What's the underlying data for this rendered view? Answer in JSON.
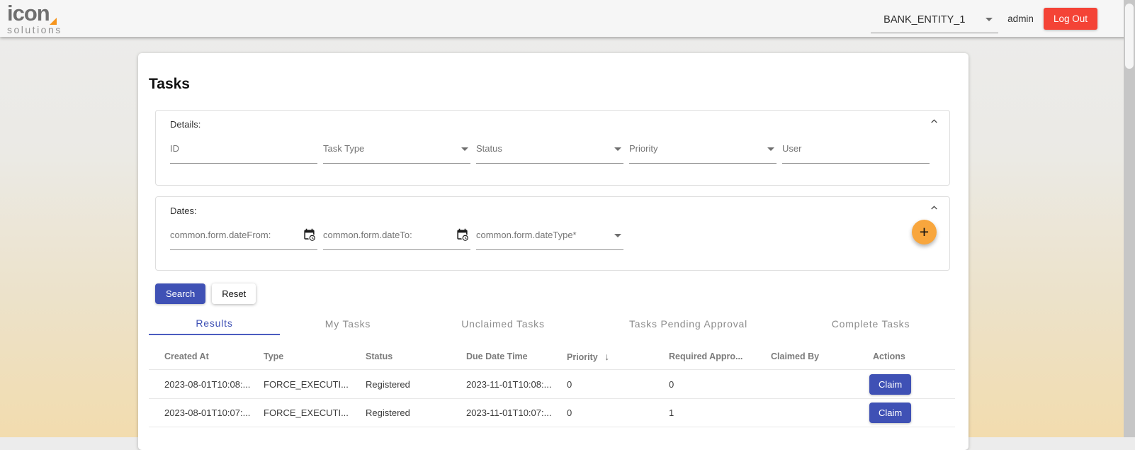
{
  "colors": {
    "primary": "#3f51b5",
    "danger": "#f44336",
    "accent_orange": "#f8a63d"
  },
  "header": {
    "logo_text": "icon",
    "logo_subtext": "solutions",
    "entity_select": {
      "value": "BANK_ENTITY_1"
    },
    "username": "admin",
    "logout_label": "Log Out"
  },
  "page_title": "Tasks",
  "details_panel": {
    "title": "Details:",
    "fields": [
      {
        "placeholder": "ID"
      },
      {
        "placeholder": "Task Type"
      },
      {
        "placeholder": "Status"
      },
      {
        "placeholder": "Priority"
      },
      {
        "placeholder": "User"
      }
    ]
  },
  "dates_panel": {
    "title": "Dates:",
    "fields": [
      {
        "placeholder": "common.form.dateFrom:"
      },
      {
        "placeholder": "common.form.dateTo:"
      },
      {
        "placeholder": "common.form.dateType*"
      }
    ],
    "add_button_label": "+"
  },
  "filter_actions": {
    "search_label": "Search",
    "reset_label": "Reset"
  },
  "tabs": [
    {
      "label": "Results",
      "active": true
    },
    {
      "label": "My Tasks",
      "active": false
    },
    {
      "label": "Unclaimed Tasks",
      "active": false
    },
    {
      "label": "Tasks Pending Approval",
      "active": false
    },
    {
      "label": "Complete Tasks",
      "active": false
    }
  ],
  "table": {
    "columns": [
      "Created At",
      "Type",
      "Status",
      "Due Date Time",
      "Priority",
      "Required Appro...",
      "Claimed By",
      "Actions"
    ],
    "sort_column": "Priority",
    "sort_icon": "↓",
    "rows": [
      {
        "created_at": "2023-08-01T10:08:...",
        "type": "FORCE_EXECUTI...",
        "status": "Registered",
        "due_date_time": "2023-11-01T10:08:...",
        "priority": "0",
        "required_approvals": "0",
        "claimed_by": "",
        "action_label": "Claim"
      },
      {
        "created_at": "2023-08-01T10:07:...",
        "type": "FORCE_EXECUTI...",
        "status": "Registered",
        "due_date_time": "2023-11-01T10:07:...",
        "priority": "0",
        "required_approvals": "1",
        "claimed_by": "",
        "action_label": "Claim"
      }
    ]
  }
}
